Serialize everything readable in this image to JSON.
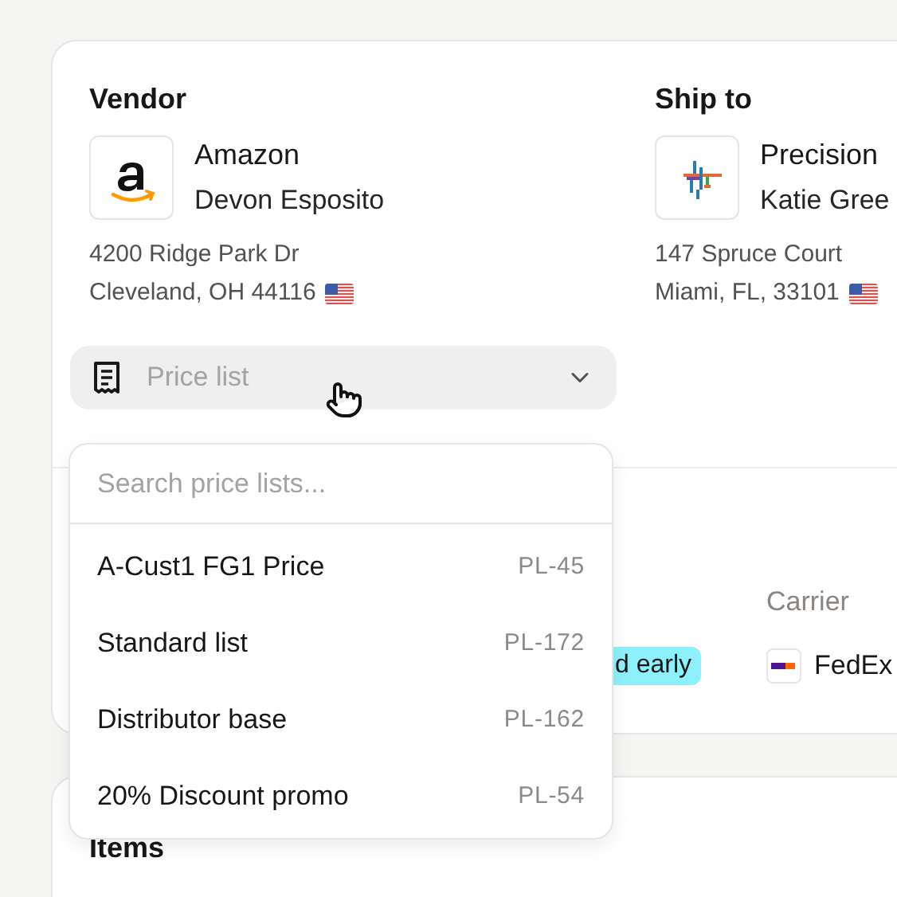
{
  "vendor": {
    "heading": "Vendor",
    "name": "Amazon",
    "contact": "Devon Esposito",
    "address_line1": "4200 Ridge Park Dr",
    "address_line2": "Cleveland, OH 44116"
  },
  "ship_to": {
    "heading": "Ship to",
    "name": "Precision",
    "contact": "Katie Gree",
    "address_line1": "147 Spruce Court",
    "address_line2": "Miami, FL, 33101"
  },
  "price_list": {
    "placeholder": "Price list",
    "expanded": true
  },
  "dropdown": {
    "search_placeholder": "Search price lists...",
    "options": [
      {
        "name": "A-Cust1 FG1 Price",
        "code": "PL-45"
      },
      {
        "name": "Standard list",
        "code": "PL-172"
      },
      {
        "name": "Distributor base",
        "code": "PL-162"
      },
      {
        "name": "20% Discount promo",
        "code": "PL-54"
      }
    ]
  },
  "shipping": {
    "badge": "d early",
    "carrier_label": "Carrier",
    "carrier": "FedEx"
  },
  "items": {
    "heading": "Items"
  }
}
